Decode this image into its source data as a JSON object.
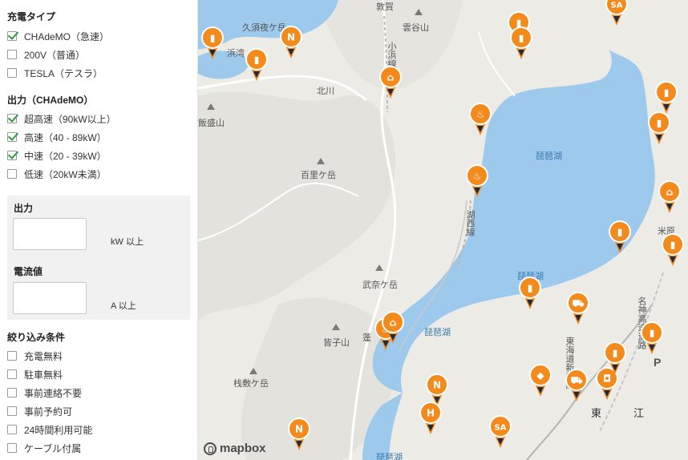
{
  "filters": {
    "charge_type": {
      "title": "充電タイプ",
      "options": [
        {
          "label": "CHAdeMO（急速）",
          "checked": true
        },
        {
          "label": "200V（普通）",
          "checked": false
        },
        {
          "label": "TESLA（テスラ）",
          "checked": false
        }
      ]
    },
    "output_chademo": {
      "title": "出力（CHAdeMO）",
      "options": [
        {
          "label": "超高速（90kW以上）",
          "checked": true
        },
        {
          "label": "高速（40 - 89kW）",
          "checked": true
        },
        {
          "label": "中速（20 - 39kW）",
          "checked": true
        },
        {
          "label": "低速（20kW未満）",
          "checked": false
        }
      ]
    },
    "output_panel": {
      "power_label": "出力",
      "power_value": "",
      "power_unit": "kW 以上",
      "current_label": "電流値",
      "current_value": "",
      "current_unit": "A 以上"
    },
    "conditions": {
      "title": "絞り込み条件",
      "options": [
        {
          "label": "充電無料",
          "checked": false
        },
        {
          "label": "駐車無料",
          "checked": false
        },
        {
          "label": "事前連絡不要",
          "checked": false
        },
        {
          "label": "事前予約可",
          "checked": false
        },
        {
          "label": "24時間利用可能",
          "checked": false
        },
        {
          "label": "ケーブル付属",
          "checked": false
        }
      ]
    }
  },
  "map": {
    "labels": {
      "kusuyagatake": "久須夜ケ岳",
      "obama_line": "小浜線",
      "unpinsan": "雲谷山",
      "hama_bay": "浜湾",
      "kitagawa": "北川",
      "iimoriyama": "飯盛山",
      "hyakurigatake": "百里ケ岳",
      "biwako_north": "琵琶湖",
      "biwako_south": "琵琶湖",
      "biwako_mid": "琵琶湖",
      "maibara": "米原",
      "kosei_line": "湖西線",
      "bunagatake": "武奈ケ岳",
      "minakosan": "皆子山",
      "hourai": "蓬",
      "shinkansen": "東海道新幹線",
      "meishin": "名神高速道路",
      "sasogatake": "栈敷ケ岳",
      "higashiomi": "東",
      "oumi": "江",
      "biwako_bottom": "琵琶湖",
      "parking_p": "P",
      "shiga_top": "敦賀"
    },
    "brand": "mapbox",
    "pin_color": "#f28a1c",
    "water_color": "#9cc9ec",
    "pins": [
      {
        "icon": "ev-station-icon"
      },
      {
        "icon": "nissan-icon"
      },
      {
        "icon": "ev-station-icon"
      },
      {
        "icon": "factory-icon"
      },
      {
        "icon": "ev-station-icon"
      },
      {
        "icon": "sa-icon"
      },
      {
        "icon": "ev-station-icon"
      },
      {
        "icon": "onsen-icon"
      },
      {
        "icon": "factory-icon"
      },
      {
        "icon": "onsen-icon"
      },
      {
        "icon": "ev-station-icon"
      },
      {
        "icon": "ev-station-icon"
      },
      {
        "icon": "shopping-cart-icon"
      },
      {
        "icon": "ev-station-icon"
      },
      {
        "icon": "onsen-icon"
      },
      {
        "icon": "factory-icon"
      },
      {
        "icon": "nissan-icon"
      },
      {
        "icon": "shopping-cart-icon"
      },
      {
        "icon": "car-dealer-icon"
      },
      {
        "icon": "mitsubishi-icon"
      },
      {
        "icon": "honda-icon"
      },
      {
        "icon": "sa-icon"
      },
      {
        "icon": "nissan-icon"
      },
      {
        "icon": "ev-station-icon"
      },
      {
        "icon": "ev-station-icon"
      },
      {
        "icon": "ev-station-icon"
      },
      {
        "icon": "ev-station-icon"
      }
    ]
  }
}
